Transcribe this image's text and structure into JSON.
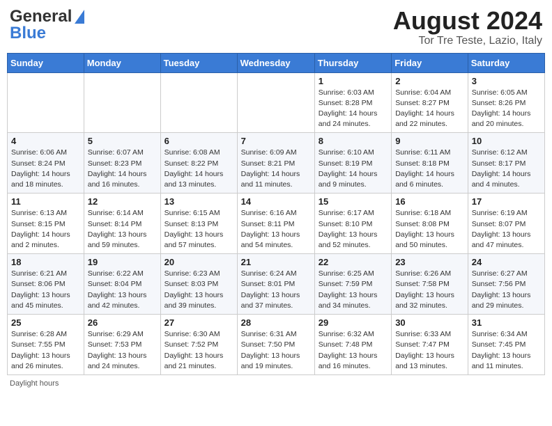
{
  "header": {
    "logo_general": "General",
    "logo_blue": "Blue",
    "month_year": "August 2024",
    "location": "Tor Tre Teste, Lazio, Italy"
  },
  "calendar": {
    "day_headers": [
      "Sunday",
      "Monday",
      "Tuesday",
      "Wednesday",
      "Thursday",
      "Friday",
      "Saturday"
    ],
    "weeks": [
      [
        {
          "day": "",
          "info": ""
        },
        {
          "day": "",
          "info": ""
        },
        {
          "day": "",
          "info": ""
        },
        {
          "day": "",
          "info": ""
        },
        {
          "day": "1",
          "info": "Sunrise: 6:03 AM\nSunset: 8:28 PM\nDaylight: 14 hours and 24 minutes."
        },
        {
          "day": "2",
          "info": "Sunrise: 6:04 AM\nSunset: 8:27 PM\nDaylight: 14 hours and 22 minutes."
        },
        {
          "day": "3",
          "info": "Sunrise: 6:05 AM\nSunset: 8:26 PM\nDaylight: 14 hours and 20 minutes."
        }
      ],
      [
        {
          "day": "4",
          "info": "Sunrise: 6:06 AM\nSunset: 8:24 PM\nDaylight: 14 hours and 18 minutes."
        },
        {
          "day": "5",
          "info": "Sunrise: 6:07 AM\nSunset: 8:23 PM\nDaylight: 14 hours and 16 minutes."
        },
        {
          "day": "6",
          "info": "Sunrise: 6:08 AM\nSunset: 8:22 PM\nDaylight: 14 hours and 13 minutes."
        },
        {
          "day": "7",
          "info": "Sunrise: 6:09 AM\nSunset: 8:21 PM\nDaylight: 14 hours and 11 minutes."
        },
        {
          "day": "8",
          "info": "Sunrise: 6:10 AM\nSunset: 8:19 PM\nDaylight: 14 hours and 9 minutes."
        },
        {
          "day": "9",
          "info": "Sunrise: 6:11 AM\nSunset: 8:18 PM\nDaylight: 14 hours and 6 minutes."
        },
        {
          "day": "10",
          "info": "Sunrise: 6:12 AM\nSunset: 8:17 PM\nDaylight: 14 hours and 4 minutes."
        }
      ],
      [
        {
          "day": "11",
          "info": "Sunrise: 6:13 AM\nSunset: 8:15 PM\nDaylight: 14 hours and 2 minutes."
        },
        {
          "day": "12",
          "info": "Sunrise: 6:14 AM\nSunset: 8:14 PM\nDaylight: 13 hours and 59 minutes."
        },
        {
          "day": "13",
          "info": "Sunrise: 6:15 AM\nSunset: 8:13 PM\nDaylight: 13 hours and 57 minutes."
        },
        {
          "day": "14",
          "info": "Sunrise: 6:16 AM\nSunset: 8:11 PM\nDaylight: 13 hours and 54 minutes."
        },
        {
          "day": "15",
          "info": "Sunrise: 6:17 AM\nSunset: 8:10 PM\nDaylight: 13 hours and 52 minutes."
        },
        {
          "day": "16",
          "info": "Sunrise: 6:18 AM\nSunset: 8:08 PM\nDaylight: 13 hours and 50 minutes."
        },
        {
          "day": "17",
          "info": "Sunrise: 6:19 AM\nSunset: 8:07 PM\nDaylight: 13 hours and 47 minutes."
        }
      ],
      [
        {
          "day": "18",
          "info": "Sunrise: 6:21 AM\nSunset: 8:06 PM\nDaylight: 13 hours and 45 minutes."
        },
        {
          "day": "19",
          "info": "Sunrise: 6:22 AM\nSunset: 8:04 PM\nDaylight: 13 hours and 42 minutes."
        },
        {
          "day": "20",
          "info": "Sunrise: 6:23 AM\nSunset: 8:03 PM\nDaylight: 13 hours and 39 minutes."
        },
        {
          "day": "21",
          "info": "Sunrise: 6:24 AM\nSunset: 8:01 PM\nDaylight: 13 hours and 37 minutes."
        },
        {
          "day": "22",
          "info": "Sunrise: 6:25 AM\nSunset: 7:59 PM\nDaylight: 13 hours and 34 minutes."
        },
        {
          "day": "23",
          "info": "Sunrise: 6:26 AM\nSunset: 7:58 PM\nDaylight: 13 hours and 32 minutes."
        },
        {
          "day": "24",
          "info": "Sunrise: 6:27 AM\nSunset: 7:56 PM\nDaylight: 13 hours and 29 minutes."
        }
      ],
      [
        {
          "day": "25",
          "info": "Sunrise: 6:28 AM\nSunset: 7:55 PM\nDaylight: 13 hours and 26 minutes."
        },
        {
          "day": "26",
          "info": "Sunrise: 6:29 AM\nSunset: 7:53 PM\nDaylight: 13 hours and 24 minutes."
        },
        {
          "day": "27",
          "info": "Sunrise: 6:30 AM\nSunset: 7:52 PM\nDaylight: 13 hours and 21 minutes."
        },
        {
          "day": "28",
          "info": "Sunrise: 6:31 AM\nSunset: 7:50 PM\nDaylight: 13 hours and 19 minutes."
        },
        {
          "day": "29",
          "info": "Sunrise: 6:32 AM\nSunset: 7:48 PM\nDaylight: 13 hours and 16 minutes."
        },
        {
          "day": "30",
          "info": "Sunrise: 6:33 AM\nSunset: 7:47 PM\nDaylight: 13 hours and 13 minutes."
        },
        {
          "day": "31",
          "info": "Sunrise: 6:34 AM\nSunset: 7:45 PM\nDaylight: 13 hours and 11 minutes."
        }
      ]
    ]
  },
  "footer": {
    "note": "Daylight hours"
  }
}
